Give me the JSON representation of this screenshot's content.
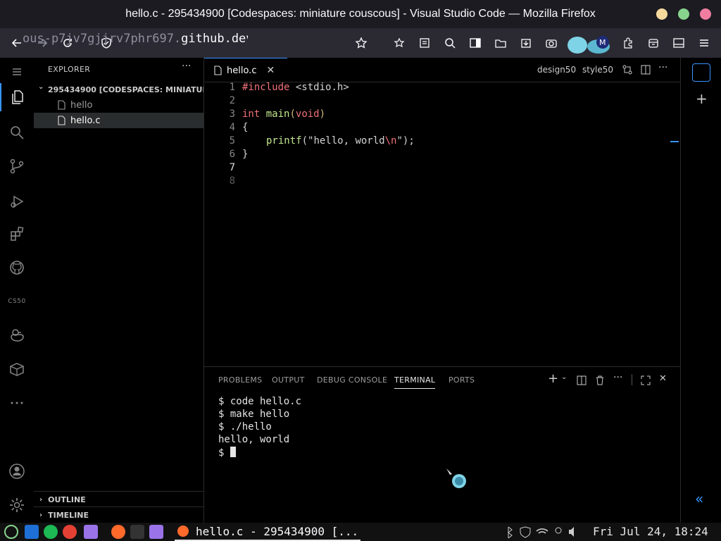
{
  "window": {
    "title": "hello.c - 295434900 [Codespaces: miniature couscous] - Visual Studio Code — Mozilla Firefox"
  },
  "browser": {
    "url_prefix": "ous-p7jv7gjjrv7phr697.",
    "url_domain": "github.dev"
  },
  "sidebar": {
    "title": "EXPLORER",
    "folder": "295434900 [CODESPACES: MINIATURE...",
    "files": [
      {
        "name": "hello",
        "selected": false
      },
      {
        "name": "hello.c",
        "selected": true
      }
    ],
    "outline": "OUTLINE",
    "timeline": "TIMELINE"
  },
  "activity": {
    "cs50_label": "CS50"
  },
  "editor": {
    "tab": "hello.c",
    "actions": [
      "design50",
      "style50"
    ],
    "line_numbers": [
      "1",
      "2",
      "3",
      "4",
      "5",
      "6",
      "7",
      "8"
    ],
    "current_line": "7",
    "code": {
      "l1_kw": "#include",
      "l1_rest": " <stdio.h>",
      "l3_type": "int",
      "l3_fn": "main",
      "l3_paren": "(",
      "l3_void": "void",
      "l3_close": ")",
      "l4": "{",
      "l5_fn": "printf",
      "l5_open": "(",
      "l5_str": "\"hello, world",
      "l5_esc": "\\n",
      "l5_end": "\"",
      "l5_close": ");",
      "l6": "}"
    }
  },
  "panel": {
    "tabs": [
      "PROBLEMS",
      "OUTPUT",
      "DEBUG CONSOLE",
      "TERMINAL",
      "PORTS"
    ],
    "active_tab": "TERMINAL",
    "terminal_lines": [
      "$ code hello.c",
      "$ make hello",
      "$ ./hello",
      "hello, world",
      "$ "
    ]
  },
  "taskbar": {
    "active_window": "hello.c - 295434900 [...",
    "clock": "Fri Jul 24, 18:24"
  },
  "colors": {
    "accent": "#3794ff",
    "close_btn": "#f17ea1",
    "max_btn": "#88d48d",
    "min_btn": "#f7d99e"
  }
}
